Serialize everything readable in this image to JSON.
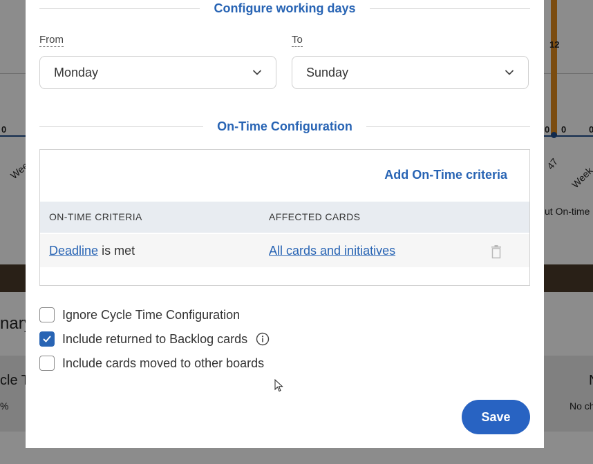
{
  "background": {
    "chart_labels": {
      "left_zero": "0",
      "bar_value": "12",
      "right_zero_a": "0",
      "right_zero_b": "0",
      "right_zero_c": "0",
      "week_left": "Wee",
      "week_right_a": "47",
      "week_right_b": "Week",
      "legend_fragment": "ut On-time"
    },
    "section_fragment": "nary",
    "tile_left_title": "cle T",
    "tile_left_value": "%",
    "tile_right_title": "N",
    "tile_right_text": "No ch"
  },
  "modal": {
    "working_days": {
      "title": "Configure working days",
      "from_label": "From",
      "to_label": "To",
      "from_value": "Monday",
      "to_value": "Sunday"
    },
    "on_time": {
      "title": "On-Time Configuration",
      "add_label": "Add On-Time criteria",
      "columns": [
        "ON-TIME CRITERIA",
        "AFFECTED CARDS"
      ],
      "rows": [
        {
          "criteria_link": "Deadline",
          "criteria_suffix": "is met",
          "affected_link": "All cards and initiatives"
        }
      ]
    },
    "options": [
      {
        "label": "Ignore Cycle Time Configuration",
        "checked": false
      },
      {
        "label": "Include returned to Backlog cards",
        "checked": true
      },
      {
        "label": "Include cards moved to other boards",
        "checked": false
      }
    ],
    "save_label": "Save"
  },
  "colors": {
    "accent": "#2864b4",
    "save_button": "#2863c2"
  }
}
